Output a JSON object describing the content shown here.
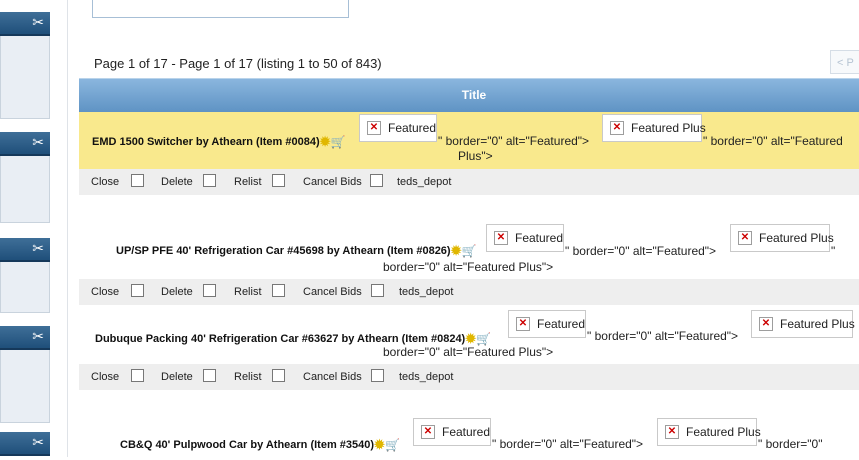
{
  "pager": {
    "text": "Page 1 of 17 - Page 1 of 17 (listing 1 to 50 of 843)",
    "prev": "< P"
  },
  "table": {
    "header": "Title"
  },
  "icons": {
    "sidebar_tool": "wrench-screwdriver-icon",
    "featured": "sun-icon",
    "cart": "cart-icon",
    "broken_image": "broken-image-icon"
  },
  "colors": {
    "header_blue": "#6f9fcd",
    "featured_row": "#f9e98d",
    "sidebar_head": "#2d5a84"
  },
  "common": {
    "featured_alt": "Featured",
    "featured_plus_alt": "Featured Plus",
    "raw_featured": "\" border=\"0\" alt=\"Featured\">",
    "raw_plus_1": "\" border=\"0\" alt=\"Featured",
    "raw_plus_2": "Plus\">",
    "raw_plus_full": "border=\"0\" alt=\"Featured Plus\">",
    "raw_plus_quote": "\"",
    "raw_plus_partial": "\" border=\"0\"",
    "close": "Close",
    "delete": "Delete",
    "relist": "Relist",
    "cancel_bids": "Cancel Bids",
    "seller": "teds_depot"
  },
  "listings": [
    {
      "title": "EMD 1500 Switcher by Athearn (Item #0084)"
    },
    {
      "title": "UP/SP PFE 40' Refrigeration Car #45698 by Athearn (Item #0826)"
    },
    {
      "title": "Dubuque Packing 40' Refrigeration Car #63627 by Athearn (Item #0824)"
    },
    {
      "title": "CB&Q 40' Pulpwood Car by Athearn (Item #3540)"
    }
  ]
}
